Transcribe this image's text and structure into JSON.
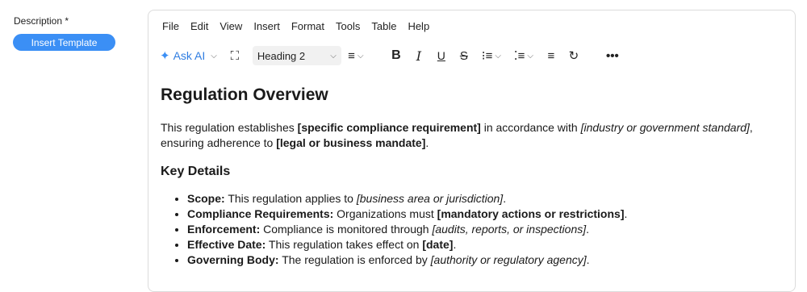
{
  "field": {
    "label": "Description *",
    "template_button": "Insert Template"
  },
  "menu": [
    "File",
    "Edit",
    "View",
    "Insert",
    "Format",
    "Tools",
    "Table",
    "Help"
  ],
  "toolbar": {
    "ask_ai": "Ask AI",
    "heading_select": "Heading 2",
    "icons": [
      "sparkle-icon",
      "fullscreen-icon",
      "align-left-icon",
      "bold-icon",
      "italic-icon",
      "underline-icon",
      "strikethrough-icon",
      "numbered-list-icon",
      "bullet-list-icon",
      "line-height-icon",
      "refresh-icon",
      "more-icon"
    ]
  },
  "document": {
    "title": "Regulation Overview",
    "para_1": "This regulation establishes ",
    "para_1_b1": "[specific compliance requirement]",
    "para_1_2": " in accordance with ",
    "para_1_i1": "[industry or government standard]",
    "para_1_3": ",",
    "para_2": "ensuring adherence to ",
    "para_2_b1": "[legal or business mandate]",
    "para_2_end": ".",
    "subheading": "Key Details",
    "items": [
      {
        "label": "Scope:",
        "text": " This regulation applies to ",
        "placeholder": "[business area or jurisdiction]",
        "style": "italic",
        "end": "."
      },
      {
        "label": "Compliance Requirements:",
        "text": " Organizations must ",
        "placeholder": "[mandatory actions or restrictions]",
        "style": "bold",
        "end": "."
      },
      {
        "label": "Enforcement:",
        "text": " Compliance is monitored through ",
        "placeholder": "[audits, reports, or inspections]",
        "style": "italic",
        "end": "."
      },
      {
        "label": "Effective Date:",
        "text": " This regulation takes effect on ",
        "placeholder": "[date]",
        "style": "bold",
        "end": "."
      },
      {
        "label": "Governing Body:",
        "text": " The regulation is enforced by ",
        "placeholder": "[authority or regulatory agency]",
        "style": "italic",
        "end": "."
      }
    ]
  },
  "colors": {
    "accent": "#3b8ff5",
    "ask_ai": "#2f7de1"
  }
}
